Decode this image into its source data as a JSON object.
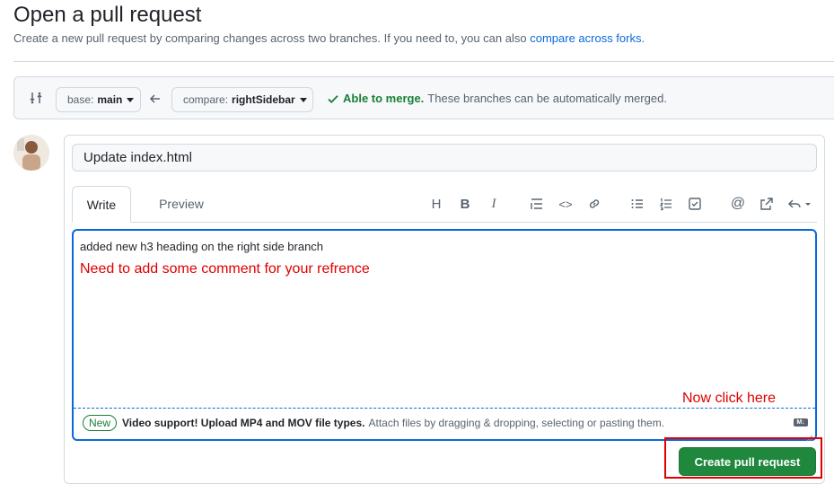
{
  "page": {
    "title": "Open a pull request",
    "subtitle_text": "Create a new pull request by comparing changes across two branches. If you need to, you can also ",
    "subtitle_link": "compare across forks",
    "subtitle_end": "."
  },
  "branch_bar": {
    "base_prefix": "base:",
    "base_value": "main",
    "compare_prefix": "compare:",
    "compare_value": "rightSidebar",
    "merge_status": "Able to merge.",
    "merge_message": "These branches can be automatically merged.",
    "status_color": "#1a7f37"
  },
  "form": {
    "title_value": "Update index.html",
    "tabs": [
      "Write",
      "Preview"
    ],
    "toolbar_icons": [
      "heading-icon",
      "bold-icon",
      "italic-icon",
      "quote-icon",
      "code-icon",
      "link-icon",
      "unordered-list-icon",
      "ordered-list-icon",
      "task-list-icon",
      "mention-icon",
      "cross-reference-icon",
      "saved-replies-icon"
    ],
    "toolbar_glyphs": {
      "heading": "H",
      "bold": "B",
      "italic": "I",
      "code": "<>",
      "mention": "@"
    },
    "body_text": "added new h3 heading on the right side branch",
    "annotation_1": "Need to add some comment for your refrence",
    "annotation_2": "Now click here",
    "footer_badge": "New",
    "footer_bold": "Video support! Upload MP4 and MOV file types.",
    "footer_rest": "Attach files by dragging & dropping, selecting or pasting them.",
    "markdown_badge": "M↓",
    "submit_label": "Create pull request",
    "submit_color": "#1f883d",
    "annotation_color": "#e00000"
  }
}
